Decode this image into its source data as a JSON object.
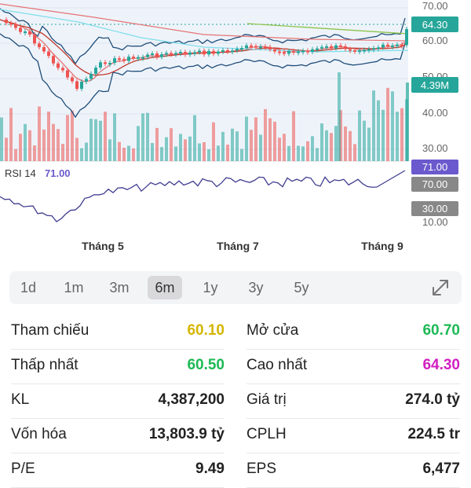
{
  "chart": {
    "y_labels": [
      "70.00",
      "60.00",
      "50.00",
      "40.00",
      "30.00",
      "10.00"
    ],
    "price_badge": "64.30",
    "volume_badge": "4.39M",
    "rsi_label": "RSI 14",
    "rsi_value": "71.00",
    "rsi_badges": [
      "71.00",
      "70.00",
      "30.00"
    ],
    "x_labels": [
      "Tháng 5",
      "Tháng 7",
      "Tháng 9"
    ],
    "colors": {
      "up": "#26a69a",
      "down": "#ef5350",
      "bollinger": "#1f4e79",
      "ma_red": "#e57373",
      "ma_orange": "#c0392b",
      "ma_cyan": "#80deea",
      "ma_green": "#8bc34a",
      "rsi": "#3f3d8f",
      "badge_green": "#26a69a",
      "badge_purple": "#6a5acd",
      "badge_gray": "#888888"
    }
  },
  "timeframes": {
    "items": [
      "1d",
      "1m",
      "3m",
      "6m",
      "1y",
      "3y",
      "5y"
    ],
    "active": "6m",
    "expand_icon": "expand-icon"
  },
  "stats": {
    "tham_chieu": {
      "label": "Tham chiếu",
      "value": "60.10",
      "color": "#d4b600"
    },
    "mo_cua": {
      "label": "Mở cửa",
      "value": "60.70",
      "color": "#1db954"
    },
    "thap_nhat": {
      "label": "Thấp nhất",
      "value": "60.50",
      "color": "#1db954"
    },
    "cao_nhat": {
      "label": "Cao nhất",
      "value": "64.30",
      "color": "#d21fbf"
    },
    "kl": {
      "label": "KL",
      "value": "4,387,200"
    },
    "gia_tri": {
      "label": "Giá trị",
      "value": "274.0 tỷ"
    },
    "von_hoa": {
      "label": "Vốn hóa",
      "value": "13,803.9 tỷ"
    },
    "cplh": {
      "label": "CPLH",
      "value": "224.5 tr"
    },
    "pe": {
      "label": "P/E",
      "value": "9.49"
    },
    "eps": {
      "label": "EPS",
      "value": "6,477"
    }
  }
}
